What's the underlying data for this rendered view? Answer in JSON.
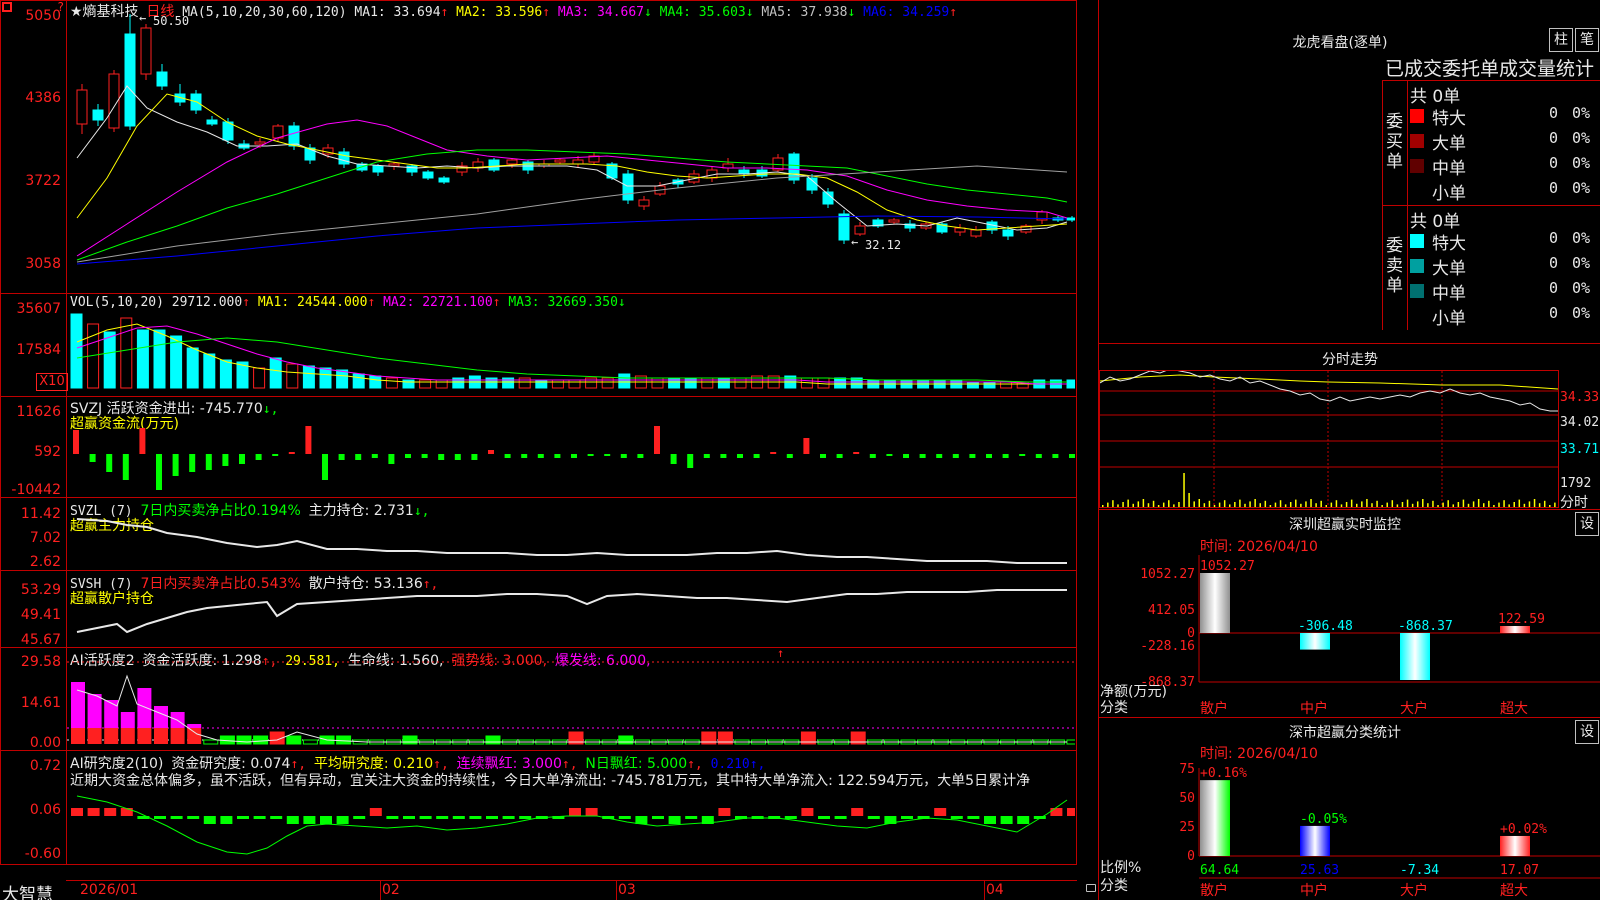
{
  "main": {
    "title": "★熵基科技",
    "period": "日线",
    "ma_header": "MA(5,10,20,30,60,120)",
    "ma": [
      {
        "text": "MA1: 33.694",
        "arrow": "↑",
        "color": "#e8e8e8"
      },
      {
        "text": "MA2: 33.596",
        "arrow": "↑",
        "color": "#ffff00"
      },
      {
        "text": "MA3: 34.667",
        "arrow": "↓",
        "color": "#ff00ff"
      },
      {
        "text": "MA4: 35.603",
        "arrow": "↓",
        "color": "#00ff00"
      },
      {
        "text": "MA5: 37.938",
        "arrow": "↓",
        "color": "#c0c0c0"
      },
      {
        "text": "MA6: 34.259",
        "arrow": "↑",
        "color": "#0000ff"
      }
    ],
    "y_labels": [
      "5050",
      "4386",
      "3722",
      "3058"
    ],
    "high_mark": "50.50",
    "low_mark": "32.12"
  },
  "vol": {
    "legend_name": "VOL(5,10,20)",
    "legend_value": "29712.000",
    "legend_arrow": "↑",
    "ma": [
      {
        "text": "MA1: 24544.000",
        "arrow": "↑",
        "color": "#ffff00"
      },
      {
        "text": "MA2: 22721.100",
        "arrow": "↑",
        "color": "#ff00ff"
      },
      {
        "text": "MA3: 32669.350",
        "arrow": "↓",
        "color": "#00ff00"
      }
    ],
    "y_labels": [
      "35607",
      "17584"
    ],
    "unit": "X10"
  },
  "svzj": {
    "line1": "SVZJ  活跃资金进出: -745.770",
    "line1_arrow": "↓,",
    "line2": "超赢资金流(万元)",
    "y_labels": [
      "11626",
      "592",
      "-10442"
    ]
  },
  "svzl": {
    "name": "SVZL (7)",
    "ratio": "7日内买卖净占比0.194%",
    "hold": "主力持仓: 2.731",
    "hold_arrow": "↓,",
    "line2": "超赢主力持仓",
    "y_labels": [
      "11.42",
      "7.02",
      "2.62"
    ]
  },
  "svsh": {
    "name": "SVSH (7)",
    "ratio": "7日内买卖净占比0.543%",
    "hold": "散户持仓: 53.136",
    "hold_arrow": "↑,",
    "line2": "超赢散户持仓",
    "y_labels": [
      "53.29",
      "49.41",
      "45.67"
    ]
  },
  "ai1": {
    "name": "AI活跃度2",
    "act": "资金活跃度: 1.298",
    "v2": "29.581,",
    "life": "生命线: 1.560,",
    "strong": "强势线: 3.000,",
    "burst": "爆发线: 6.000,",
    "y_labels": [
      "29.58",
      "14.61",
      "0.00"
    ]
  },
  "ai2": {
    "name": "AI研究度2(10)",
    "research": "资金研究度: 0.074",
    "avg": "平均研究度: 0.210",
    "cont": "连续飘红: 3.000",
    "nday": "N日飘红: 5.000",
    "last": "0.210",
    "comment": "近期大资金总体偏多，虽不活跃，但有异动，宜关注大资金的持续性，今日大单净流出: -745.781万元，其中特大单净流入: 122.594万元，大单5日累计净",
    "y_labels": [
      "0.72",
      "0.06",
      "-0.60"
    ]
  },
  "xaxis": {
    "brand": "大智慧",
    "labels": [
      "2026/01",
      "02",
      "03",
      "04"
    ]
  },
  "longhu": {
    "title": "龙虎看盘(逐单)",
    "btn_zhu": "柱",
    "btn_bi": "笔",
    "header": "已成交委托单成交量统计",
    "buy_side": "委买单",
    "sell_side": "委卖单",
    "buy_total": "共 0单",
    "sell_total": "共 0单",
    "buy_rows": [
      {
        "name": "特大",
        "val": "0",
        "pct": "0%",
        "color": "#ff0000"
      },
      {
        "name": "大单",
        "val": "0",
        "pct": "0%",
        "color": "#a00000"
      },
      {
        "name": "中单",
        "val": "0",
        "pct": "0%",
        "color": "#600000"
      },
      {
        "name": "小单",
        "val": "0",
        "pct": "0%",
        "color": "#000000"
      }
    ],
    "sell_rows": [
      {
        "name": "特大",
        "val": "0",
        "pct": "0%",
        "color": "#00ffff"
      },
      {
        "name": "大单",
        "val": "0",
        "pct": "0%",
        "color": "#00a0a0"
      },
      {
        "name": "中单",
        "val": "0",
        "pct": "0%",
        "color": "#007070"
      },
      {
        "name": "小单",
        "val": "0",
        "pct": "0%",
        "color": "#000000"
      }
    ]
  },
  "intraday": {
    "title": "分时走势",
    "labels": [
      "34.33",
      "34.02",
      "33.71"
    ],
    "vol_label": "1792",
    "vol_unit": "分时"
  },
  "monitor": {
    "title": "深圳超赢实时监控",
    "btn": "设",
    "time": "时间: 2026/04/10",
    "y_labels": [
      "1052.27",
      "412.05",
      "0",
      "-228.16",
      "-868.37"
    ],
    "y_title": "净额(万元)",
    "x_title": "分类",
    "categories": [
      "散户",
      "中户",
      "大户",
      "超大"
    ],
    "values": [
      1052.27,
      -306.48,
      -868.37,
      122.59
    ],
    "value_labels": [
      "1052.27",
      "-306.48",
      "-868.37",
      "122.59"
    ]
  },
  "stats": {
    "title": "深市超赢分类统计",
    "btn": "设",
    "time": "时间: 2026/04/10",
    "y_labels": [
      "75",
      "50",
      "25",
      "0"
    ],
    "y_title": "比例%",
    "x_title": "分类",
    "categories": [
      "散户",
      "中户",
      "大户",
      "超大"
    ],
    "bar_labels": [
      "+0.16%",
      "-0.05%",
      "",
      "+0.02%"
    ],
    "bottom_values": [
      "64.64",
      "25.63",
      "-7.34",
      "17.07"
    ],
    "values": [
      64.64,
      25.63,
      -7.34,
      17.07
    ]
  },
  "chart_data": {
    "type": "bar",
    "title": "深圳超赢实时监控",
    "categories": [
      "散户",
      "中户",
      "大户",
      "超大"
    ],
    "values": [
      1052.27,
      -306.48,
      -868.37,
      122.59
    ],
    "ylabel": "净额(万元)",
    "xlabel": "分类",
    "ylim": [
      -868.37,
      1052.27
    ]
  }
}
